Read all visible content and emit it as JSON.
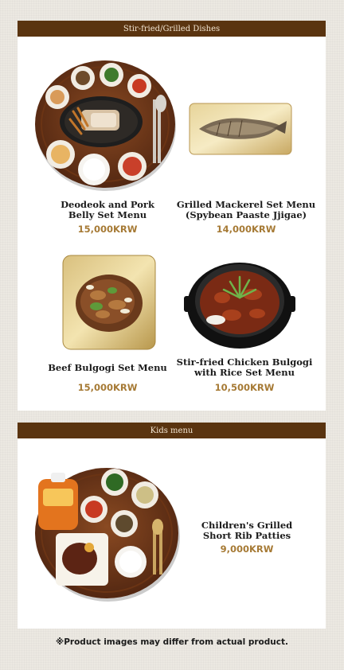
{
  "sections": [
    {
      "title": "Stir-fried/Grilled Dishes",
      "items": [
        {
          "name_line1": "Deodeok and Pork",
          "name_line2": "Belly Set Menu",
          "price": "15,000KRW",
          "image": "deodeok-pork-belly-tray-photo"
        },
        {
          "name_line1": "Grilled Mackerel Set Menu",
          "name_line2": "(Spybean Paaste Jjigae)",
          "price": "14,000KRW",
          "image": "grilled-mackerel-plate-photo"
        },
        {
          "name_line1": "Beef Bulgogi Set Menu",
          "name_line2": "",
          "price": "15,000KRW",
          "image": "beef-bulgogi-plate-photo"
        },
        {
          "name_line1": "Stir-fried Chicken Bulgogi",
          "name_line2": "with Rice Set Menu",
          "price": "10,500KRW",
          "image": "chicken-bulgogi-pot-photo"
        }
      ]
    },
    {
      "title": "Kids menu",
      "items": [
        {
          "name_line1": "Children's Grilled",
          "name_line2": "Short Rib Patties",
          "price": "9,000KRW",
          "image": "kids-short-rib-tray-photo"
        }
      ]
    }
  ],
  "footer_note": "※Product images may differ from actual product.",
  "colors": {
    "section_bar": "#5a3410",
    "price": "#a67a35",
    "panel": "#ffffff"
  }
}
